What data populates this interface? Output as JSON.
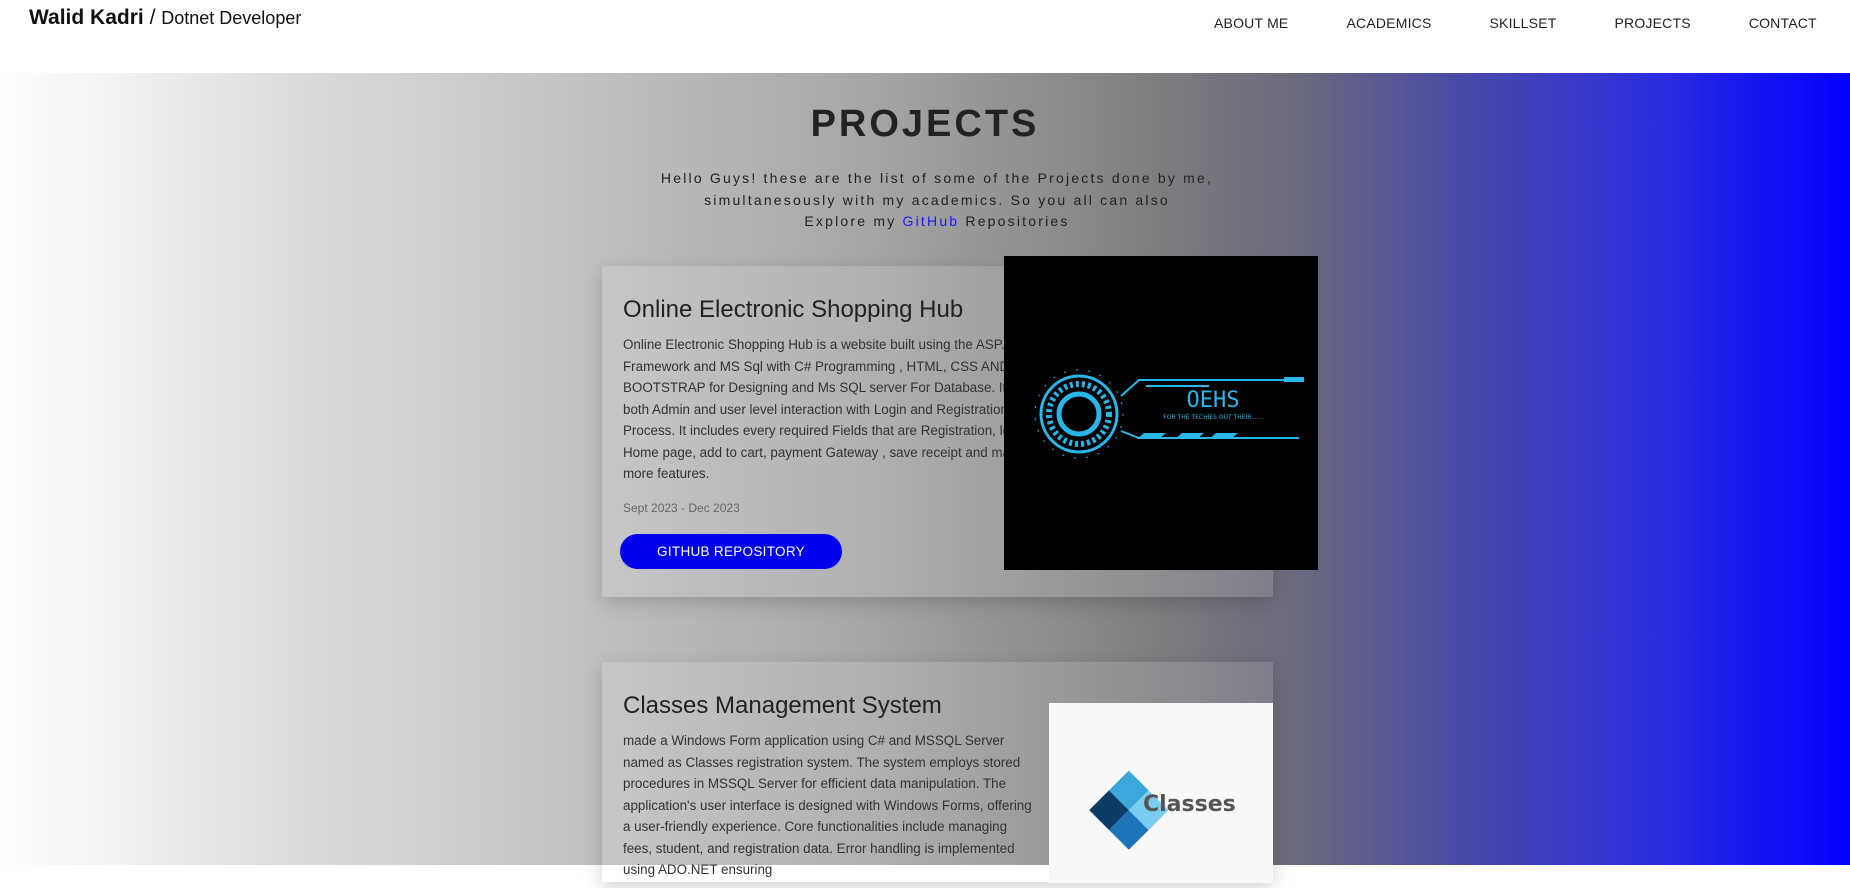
{
  "header": {
    "brand_name": "Walid Kadri",
    "brand_sep": " / ",
    "brand_role": "Dotnet Developer",
    "nav": [
      "ABOUT ME",
      "ACADEMICS",
      "SKILLSET",
      "PROJECTS",
      "CONTACT"
    ]
  },
  "projects_section": {
    "title": "PROJECTS",
    "intro_line1": "Hello Guys! these are the list of some of the Projects done by me,",
    "intro_line2": "simultanesously with my academics. So you all can also",
    "intro_line3_pre": "Explore my ",
    "intro_link": "GitHub",
    "intro_line3_post": " Repositories"
  },
  "projects": [
    {
      "title": "Online Electronic Shopping Hub",
      "description": "Online Electronic Shopping Hub is a website built using the ASP.NET Framework and MS Sql with C# Programming , HTML, CSS AND BOOTSTRAP for Designing and Ms SQL server For Database. It has both Admin and user level interaction with Login and Registration Process. It includes every required Fields that are Registration, login, Home page, add to cart, payment Gateway , save receipt and many more features.",
      "date": "Sept 2023 - Dec 2023",
      "button": "GITHUB REPOSITORY",
      "image_text": "OEHS",
      "image_subtext": "FOR THE TECHIES OUT THEIR......"
    },
    {
      "title": "Classes Management System",
      "description": "made a Windows Form application using C# and MSSQL Server named as Classes registration system. The system employs stored procedures in MSSQL Server for efficient data manipulation. The application's user interface is designed with Windows Forms, offering a user-friendly experience. Core functionalities include managing fees, student, and registration data. Error handling is implemented using ADO.NET ensuring",
      "image_text": "Classes"
    }
  ],
  "colors": {
    "accent": "#0000ee",
    "gradient_end": "#0000ff",
    "logo_cyan": "#29b6e8"
  }
}
